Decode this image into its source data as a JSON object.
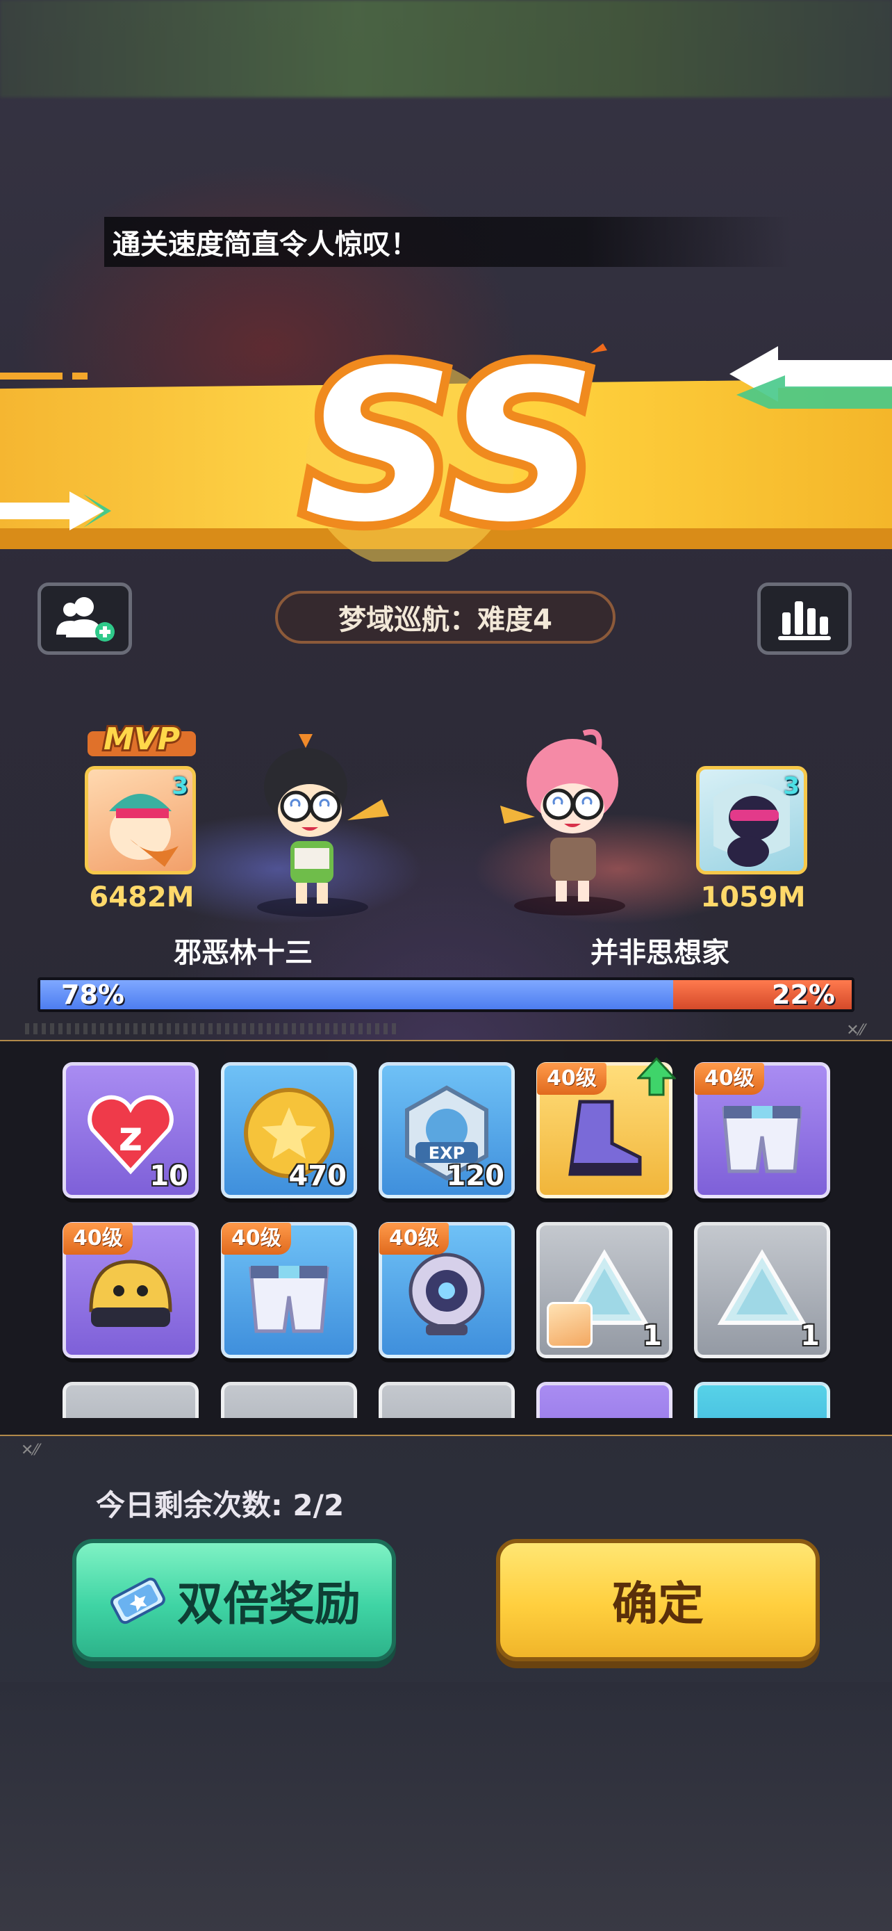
{
  "banner": {
    "message": "通关速度简直令人惊叹！"
  },
  "rank": {
    "grade": "SS"
  },
  "stage": {
    "title": "梦域巡航：难度4"
  },
  "players": [
    {
      "name": "邪恶林十三",
      "damage": "6482M",
      "level": "3",
      "mvp_label": "MVP",
      "share_percent": 78,
      "share_label": "78%"
    },
    {
      "name": "并非思想家",
      "damage": "1059M",
      "level": "3",
      "share_percent": 22,
      "share_label": "22%"
    }
  ],
  "rewards": [
    {
      "icon": "heart-icon",
      "quantity": "10",
      "color": "purple"
    },
    {
      "icon": "gold-coin-icon",
      "quantity": "470",
      "color": "blue"
    },
    {
      "icon": "exp-badge-icon",
      "quantity": "120",
      "color": "blue"
    },
    {
      "icon": "boots-icon",
      "level": "40级",
      "color": "gold",
      "upgrade": true
    },
    {
      "icon": "shorts-icon",
      "level": "40级",
      "color": "purple"
    },
    {
      "icon": "helmet-icon",
      "level": "40级",
      "color": "purple"
    },
    {
      "icon": "shorts-icon",
      "level": "40级",
      "color": "blue"
    },
    {
      "icon": "eye-orb-icon",
      "level": "40级",
      "color": "blue"
    },
    {
      "icon": "crystal-shard-icon",
      "quantity": "1",
      "color": "gray",
      "owner_avatar": true
    },
    {
      "icon": "crystal-shard-icon",
      "quantity": "1",
      "color": "gray"
    }
  ],
  "footer": {
    "remaining": "今日剩余次数: 2/2",
    "double_label": "双倍奖励",
    "confirm_label": "确定"
  },
  "colors": {
    "accent_yellow": "#ffcf3e",
    "accent_green": "#3fd4a4",
    "team_blue": "#4d7df0",
    "team_red": "#d44a2a"
  }
}
